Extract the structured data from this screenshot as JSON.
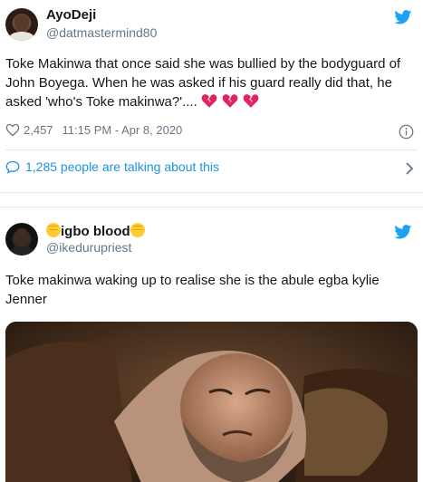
{
  "tweet1": {
    "name": "AyoDeji",
    "handle": "@datmastermind80",
    "text": "Toke Makinwa that once said she was bullied by the bodyguard of John Boyega. When he was asked if his guard really did that, he asked 'who's Toke makinwa?'....",
    "emoji": "broken-heart-icon x3",
    "like_count": "2,457",
    "timestamp": "11:15 PM - Apr 8, 2020",
    "talking": "1,285 people are talking about this"
  },
  "tweet2": {
    "name": "igbo blood",
    "handle": "@ikedurupriest",
    "text": "Toke makinwa waking up to realise she is the abule egba kylie Jenner"
  },
  "colors": {
    "link": "#1b95e0",
    "muted": "#657786",
    "text": "#14171a",
    "heart": "#e0245e"
  }
}
